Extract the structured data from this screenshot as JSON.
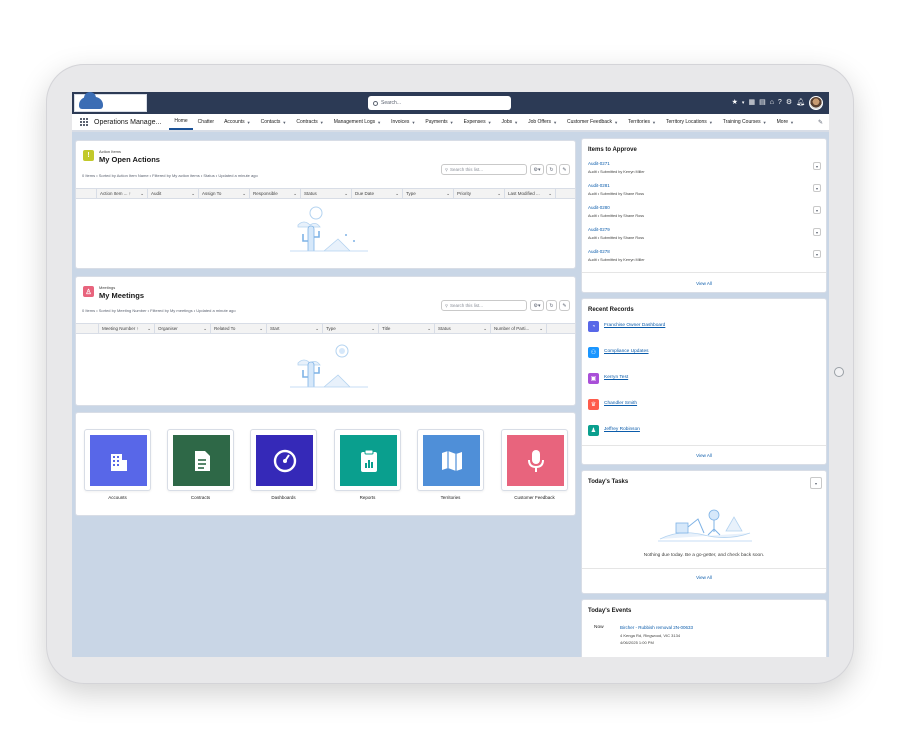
{
  "header": {
    "search_placeholder": "Search..."
  },
  "nav": {
    "app_name": "Operations Manage...",
    "items": [
      {
        "label": "Home",
        "dropdown": false
      },
      {
        "label": "Chatter",
        "dropdown": false
      },
      {
        "label": "Accounts",
        "dropdown": true
      },
      {
        "label": "Contacts",
        "dropdown": true
      },
      {
        "label": "Contracts",
        "dropdown": true
      },
      {
        "label": "Management Logs",
        "dropdown": true
      },
      {
        "label": "Invoices",
        "dropdown": true
      },
      {
        "label": "Payments",
        "dropdown": true
      },
      {
        "label": "Expenses",
        "dropdown": true
      },
      {
        "label": "Jobs",
        "dropdown": true
      },
      {
        "label": "Job Offers",
        "dropdown": true
      },
      {
        "label": "Customer Feedback",
        "dropdown": true
      },
      {
        "label": "Territories",
        "dropdown": true
      },
      {
        "label": "Territory Locations",
        "dropdown": true
      },
      {
        "label": "Training Courses",
        "dropdown": true
      },
      {
        "label": "More",
        "dropdown": true
      }
    ]
  },
  "actions": {
    "subtitle": "Action Items",
    "title": "My Open Actions",
    "meta": "0 Items • Sorted by Action Item Name • Filtered by My action items • Status • Updated a minute ago",
    "search_placeholder": "Search this list...",
    "columns": [
      "Action Item ... ↑",
      "Audit",
      "Assign To",
      "Responsible",
      "Status",
      "Due Date",
      "Type",
      "Priority",
      "Last Modified ..."
    ]
  },
  "meetings": {
    "subtitle": "Meetings",
    "title": "My Meetings",
    "meta": "0 Items • Sorted by Meeting Number • Filtered by My meetings • Updated a minute ago",
    "search_placeholder": "Search this list...",
    "columns": [
      "Meeting Number ↑",
      "Organiser",
      "Related To",
      "Start",
      "Type",
      "Title",
      "Status",
      "Number of Parti..."
    ]
  },
  "tiles": [
    {
      "label": "Accounts",
      "color": "#5867e8",
      "icon": "building-icon"
    },
    {
      "label": "Contracts",
      "color": "#2e6847",
      "icon": "document-icon"
    },
    {
      "label": "Dashboards",
      "color": "#3529b8",
      "icon": "gauge-icon"
    },
    {
      "label": "Reports",
      "color": "#0a9f8e",
      "icon": "clipboard-icon"
    },
    {
      "label": "Territories",
      "color": "#4f8fd8",
      "icon": "map-icon"
    },
    {
      "label": "Customer Feedback",
      "color": "#e8647d",
      "icon": "microphone-icon"
    }
  ],
  "approvals": {
    "title": "Items to Approve",
    "items": [
      {
        "name": "Audit-0271",
        "sub": "Audit • Submitted by Kerryn Miller"
      },
      {
        "name": "Audit-0281",
        "sub": "Audit • Submitted by Shane Ross"
      },
      {
        "name": "Audit-0280",
        "sub": "Audit • Submitted by Shane Ross"
      },
      {
        "name": "Audit-0279",
        "sub": "Audit • Submitted by Shane Ross"
      },
      {
        "name": "Audit-0278",
        "sub": "Audit • Submitted by Kerryn Miller"
      }
    ],
    "view_all": "View All"
  },
  "recent": {
    "title": "Recent Records",
    "items": [
      {
        "name": "Franchise Owner Dashboard",
        "color": "#5867e8",
        "icon": "gauge-icon"
      },
      {
        "name": "Compliance Updates",
        "color": "#1b96ff",
        "icon": "group-icon"
      },
      {
        "name": "Kerryn Test",
        "color": "#a94fd8",
        "icon": "contact-icon"
      },
      {
        "name": "Chandler Smith",
        "color": "#fe5c4c",
        "icon": "crown-icon"
      },
      {
        "name": "Jeffrey Robinson",
        "color": "#0a9f8e",
        "icon": "person-icon"
      }
    ],
    "view_all": "View All"
  },
  "tasks": {
    "title": "Today's Tasks",
    "empty": "Nothing due today. Be a go-getter, and check back soon.",
    "view_all": "View All"
  },
  "events": {
    "title": "Today's Events",
    "items": [
      {
        "time": "Now",
        "name": "Bircher - Rubbish removal 2N-00633",
        "addr": "4 Kenga Rd, Ringwood, VIC 3134",
        "when": "4/06/2025 1:00 PM"
      }
    ]
  }
}
